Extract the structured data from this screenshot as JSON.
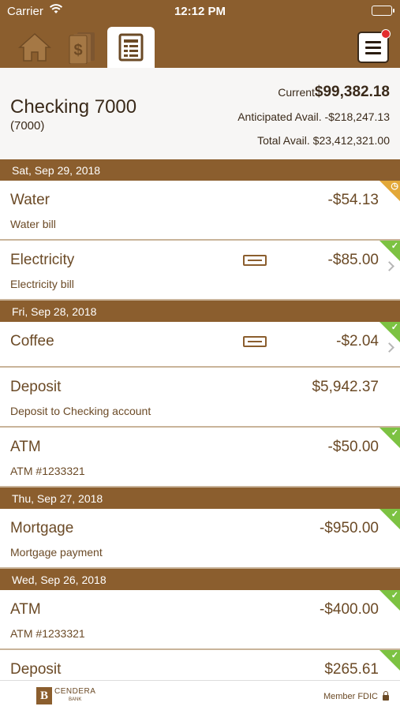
{
  "status_bar": {
    "carrier": "Carrier",
    "time": "12:12 PM"
  },
  "tabs": [
    {
      "name": "home",
      "icon": "home-icon"
    },
    {
      "name": "transfer",
      "icon": "money-icon"
    },
    {
      "name": "register",
      "icon": "ledger-icon",
      "active": true
    }
  ],
  "menu": {
    "icon": "hamburger-menu-icon",
    "notification": true
  },
  "account": {
    "name": "Checking 7000",
    "number": "(7000)",
    "current_label": "Current",
    "current_value": "$99,382.18",
    "anticipated": "Anticipated Avail. -$218,247.13",
    "total": "Total Avail. $23,412,321.00"
  },
  "groups": [
    {
      "date": "Sat, Sep 29, 2018"
    },
    {
      "date": "Fri, Sep 28, 2018"
    },
    {
      "date": "Thu, Sep 27, 2018"
    },
    {
      "date": "Wed, Sep 26, 2018"
    }
  ],
  "transactions": [
    {
      "name": "Water",
      "description": "Water bill",
      "amount": "-$54.13",
      "status": "pending"
    },
    {
      "name": "Electricity",
      "description": "Electricity bill",
      "amount": "-$85.00",
      "status": "cleared",
      "card": true,
      "chevron": true
    },
    {
      "name": "Coffee",
      "description": "",
      "amount": "-$2.04",
      "status": "cleared",
      "card": true,
      "chevron": true
    },
    {
      "name": "Deposit",
      "description": "Deposit to Checking account",
      "amount": "$5,942.37",
      "status": "none"
    },
    {
      "name": "ATM",
      "description": "ATM #1233321",
      "amount": "-$50.00",
      "status": "cleared"
    },
    {
      "name": "Mortgage",
      "description": "Mortgage payment",
      "amount": "-$950.00",
      "status": "cleared"
    },
    {
      "name": "ATM",
      "description": "ATM #1233321",
      "amount": "-$400.00",
      "status": "cleared"
    },
    {
      "name": "Deposit",
      "description": "",
      "amount": "$265.61",
      "status": "cleared"
    }
  ],
  "footer": {
    "brand": "CENDERA",
    "brand_sub": "BANK",
    "fdic": "Member FDIC"
  },
  "colors": {
    "brand_brown": "#8b5e2e",
    "cleared_green": "#7cc242",
    "pending_orange": "#e3a838",
    "notification_red": "#e32c2c"
  }
}
